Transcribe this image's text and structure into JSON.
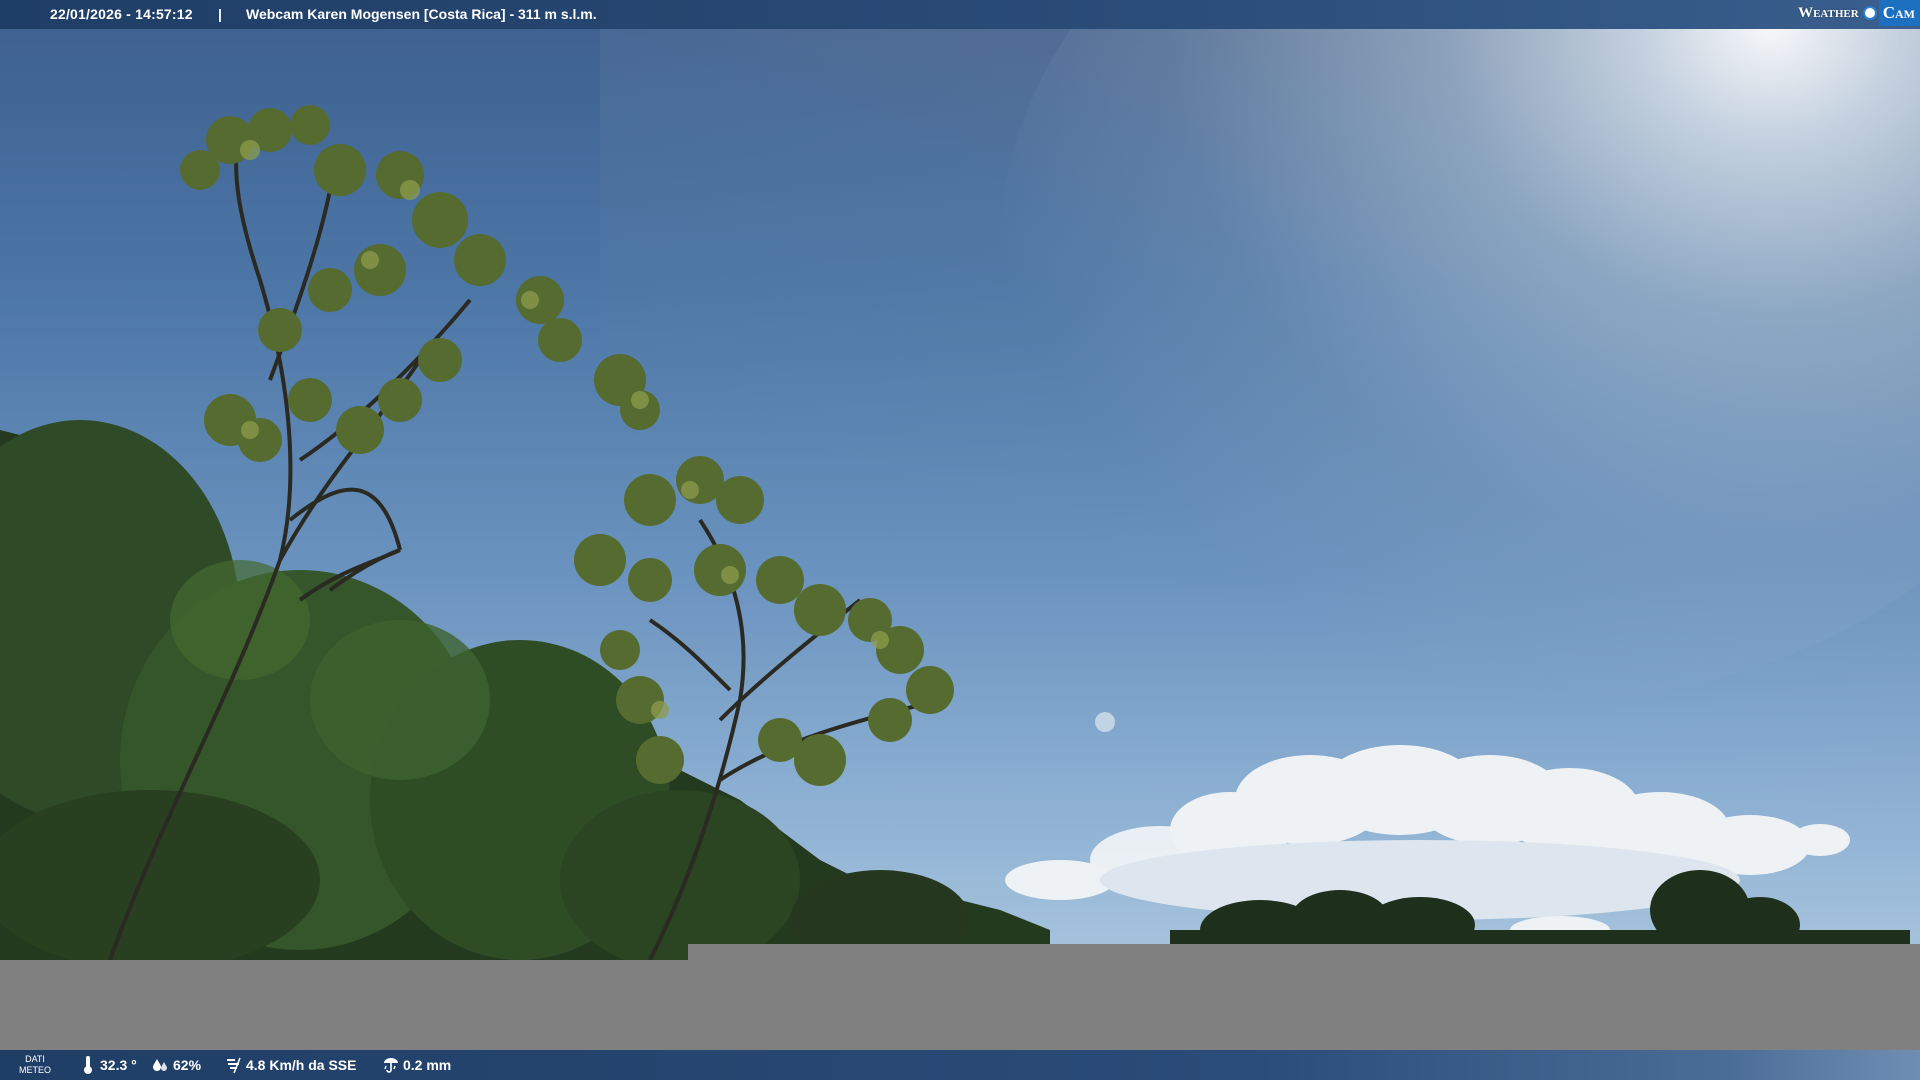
{
  "top_bar": {
    "datetime": "22/01/2026 - 14:57:12",
    "separator": "|",
    "cam_title": "Webcam Karen Mogensen [Costa Rica]  - 311 m s.l.m."
  },
  "brand": {
    "weather": "Weather",
    "cam": "Cam"
  },
  "weather_bar": {
    "label_line1": "DATI",
    "label_line2": "METEO",
    "temperature": "32.3 °",
    "humidity": "62%",
    "wind": "4.8 Km/h da SSE",
    "rain": "0.2 mm"
  },
  "icons": {
    "temperature": "thermometer-icon",
    "humidity": "humidity-drops-icon",
    "wind": "wind-icon",
    "rain": "rain-gauge-icon"
  },
  "colors": {
    "bar_background": "#1f3e66",
    "brand_accent": "#1d6fc0",
    "panel_grey": "#808080"
  }
}
